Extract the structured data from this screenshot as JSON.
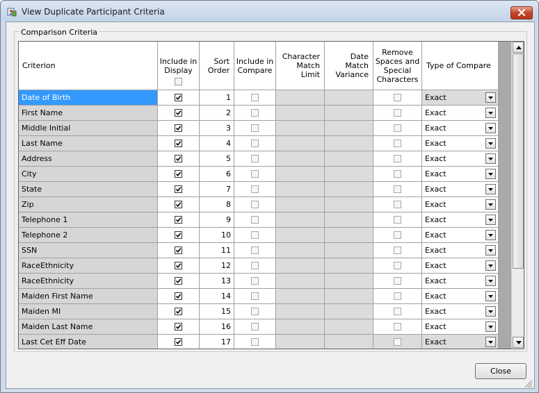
{
  "window": {
    "title": "View Duplicate Participant Criteria"
  },
  "group": {
    "label": "Comparison Criteria"
  },
  "columns": {
    "criterion": "Criterion",
    "include_display": "Include in Display",
    "sort_order": "Sort Order",
    "include_compare": "Include in Compare",
    "char_limit": "Character Match Limit",
    "date_variance": "Date Match Variance",
    "remove_spaces": "Remove Spaces and Special Characters",
    "type_compare": "Type of Compare"
  },
  "rows": [
    {
      "criterion": "Date of Birth",
      "sort": "1",
      "display": true,
      "type": "Exact"
    },
    {
      "criterion": "First Name",
      "sort": "2",
      "display": true,
      "type": "Exact"
    },
    {
      "criterion": "Middle Initial",
      "sort": "3",
      "display": true,
      "type": "Exact"
    },
    {
      "criterion": "Last Name",
      "sort": "4",
      "display": true,
      "type": "Exact"
    },
    {
      "criterion": "Address",
      "sort": "5",
      "display": true,
      "type": "Exact"
    },
    {
      "criterion": "City",
      "sort": "6",
      "display": true,
      "type": "Exact"
    },
    {
      "criterion": "State",
      "sort": "7",
      "display": true,
      "type": "Exact"
    },
    {
      "criterion": "Zip",
      "sort": "8",
      "display": true,
      "type": "Exact"
    },
    {
      "criterion": "Telephone 1",
      "sort": "9",
      "display": true,
      "type": "Exact"
    },
    {
      "criterion": "Telephone 2",
      "sort": "10",
      "display": true,
      "type": "Exact"
    },
    {
      "criterion": "SSN",
      "sort": "11",
      "display": true,
      "type": "Exact"
    },
    {
      "criterion": "RaceEthnicity",
      "sort": "12",
      "display": true,
      "type": "Exact"
    },
    {
      "criterion": "RaceEthnicity",
      "sort": "13",
      "display": true,
      "type": "Exact"
    },
    {
      "criterion": "Maiden First Name",
      "sort": "14",
      "display": true,
      "type": "Exact"
    },
    {
      "criterion": "Maiden MI",
      "sort": "15",
      "display": true,
      "type": "Exact"
    },
    {
      "criterion": "Maiden Last Name",
      "sort": "16",
      "display": true,
      "type": "Exact"
    },
    {
      "criterion": "Last Cet Eff Date",
      "sort": "17",
      "display": true,
      "type": "Exact"
    }
  ],
  "buttons": {
    "close": "Close"
  },
  "colors": {
    "selection": "#3399ff",
    "title_close": "#c4452b"
  }
}
